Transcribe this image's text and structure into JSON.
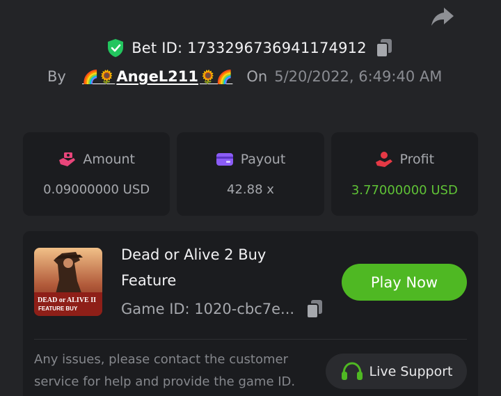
{
  "bet": {
    "id_text": "Bet ID: 1733296736941174912",
    "by_label": "By",
    "username": "AngeL211",
    "user_emoji_left": "🌈🌻",
    "user_emoji_right": "🌻🌈",
    "on_label": "On",
    "date": "5/20/2022, 6:49:40 AM"
  },
  "stats": [
    {
      "label": "Amount",
      "value": "0.09000000 USD",
      "icon": "money-hand-icon"
    },
    {
      "label": "Payout",
      "value": "42.88 x",
      "icon": "card-icon"
    },
    {
      "label": "Profit",
      "value": "3.77000000 USD",
      "icon": "profit-hand-icon"
    }
  ],
  "game": {
    "title": "Dead or Alive 2 Buy Feature",
    "id_text": "Game ID: 1020-cbc7e...",
    "thumb_line1": "DEAD or ALIVE II",
    "thumb_line2": "FEATURE BUY",
    "play_label": "Play Now"
  },
  "support": {
    "message": "Any issues, please contact the customer service for help and provide the game ID.",
    "button_label": "Live Support"
  },
  "colors": {
    "background": "#232427",
    "card": "#1b1c1f",
    "accent_green": "#4fb823",
    "profit_green": "#5fc236",
    "verified_green": "#22c55e",
    "amount_pink": "#e8457a",
    "payout_purple": "#8b5cf6",
    "profit_red": "#e53945"
  }
}
